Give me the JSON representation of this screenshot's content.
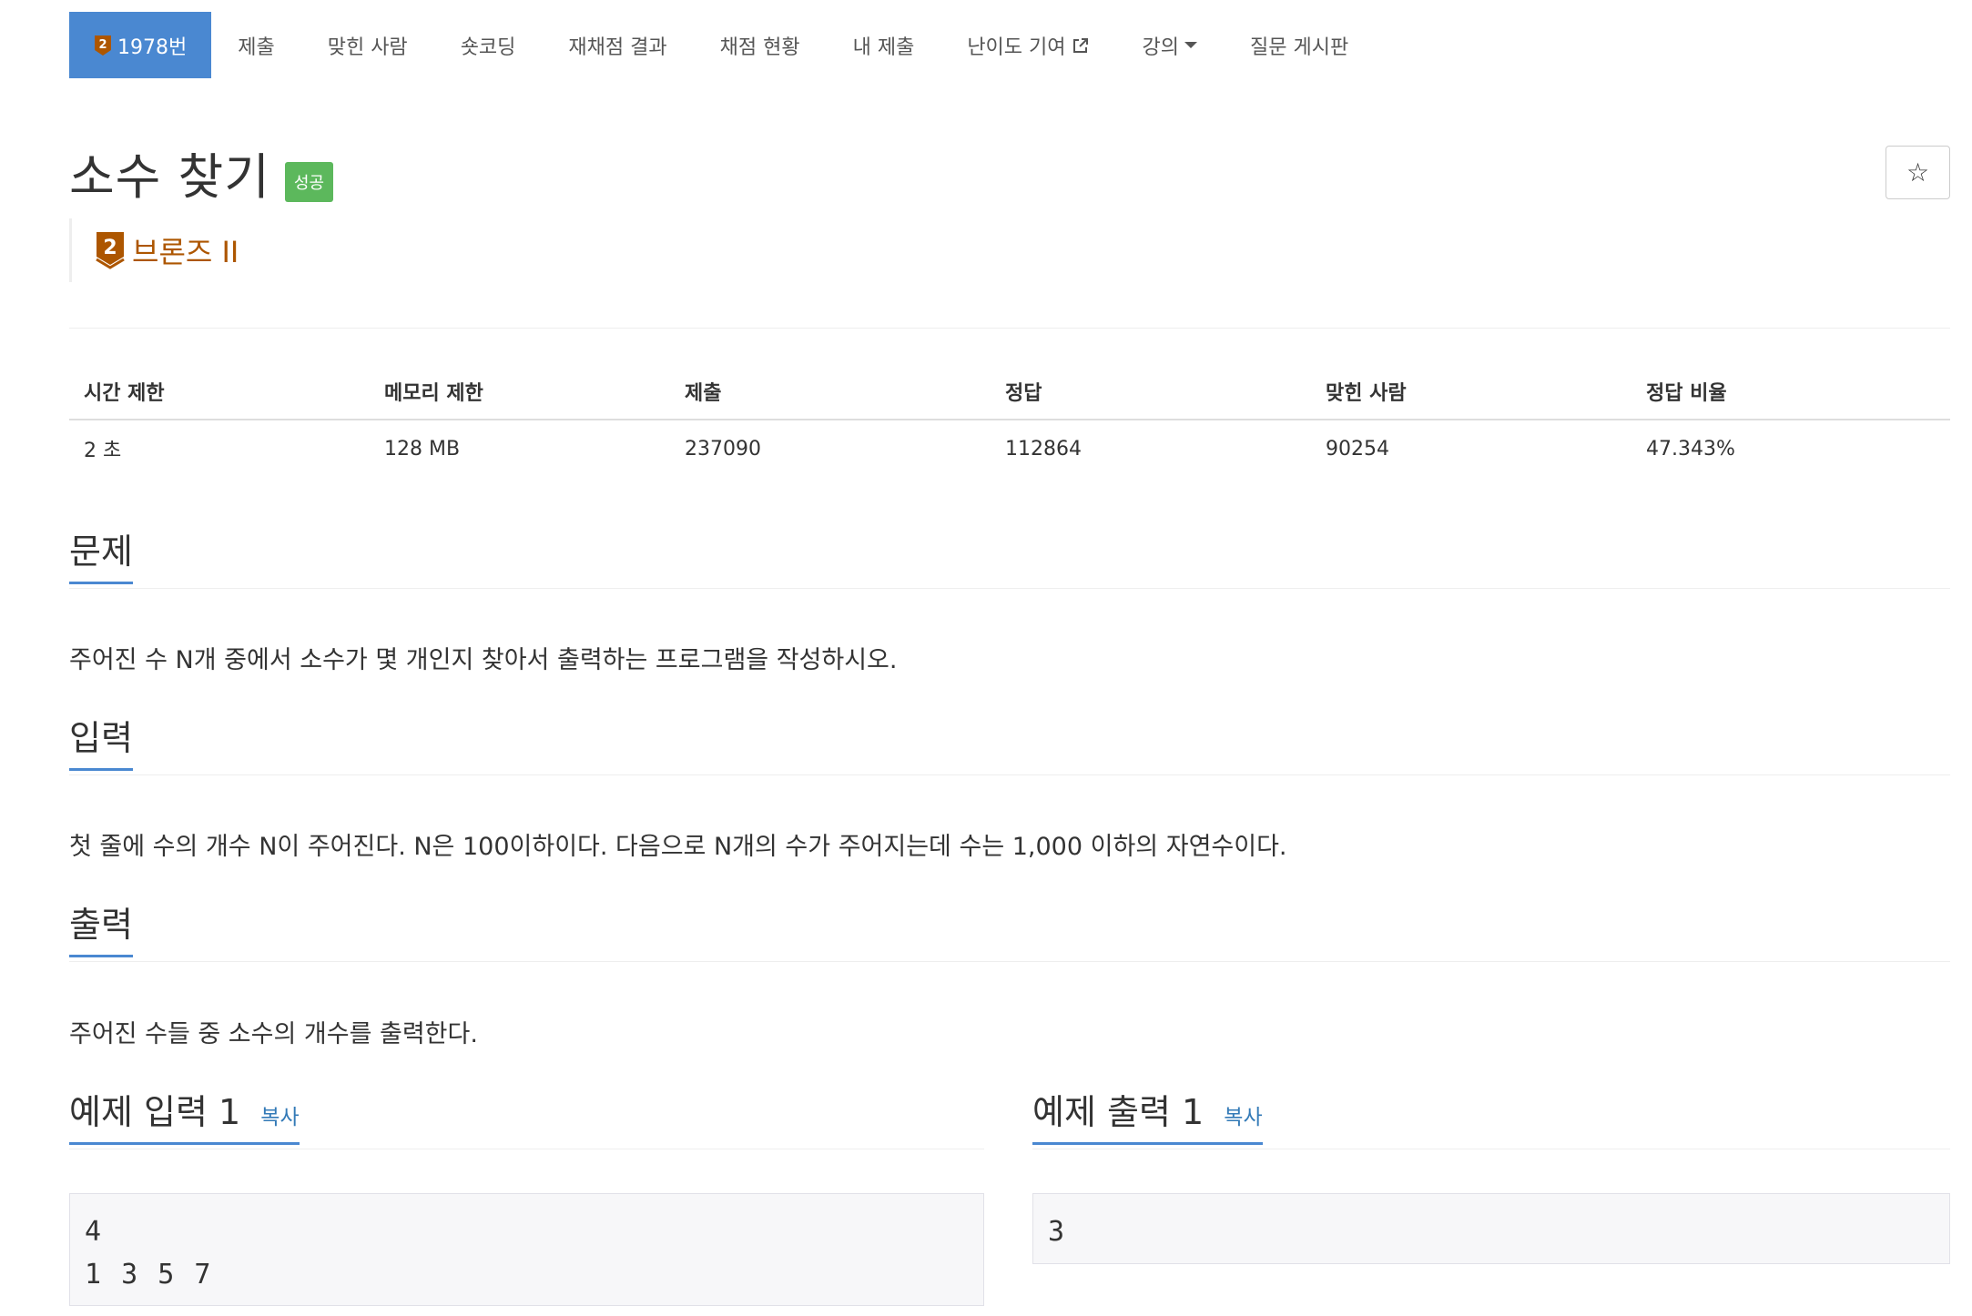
{
  "nav": {
    "problem_id": "1978번",
    "items": [
      "제출",
      "맞힌 사람",
      "숏코딩",
      "재채점 결과",
      "채점 현황",
      "내 제출",
      "난이도 기여",
      "강의",
      "질문 게시판"
    ]
  },
  "tier": {
    "level": "2",
    "name": "브론즈 II",
    "color": "#ad5600"
  },
  "title": "소수 찾기",
  "status_badge": "성공",
  "star": "☆",
  "info": {
    "headers": [
      "시간 제한",
      "메모리 제한",
      "제출",
      "정답",
      "맞힌 사람",
      "정답 비율"
    ],
    "values": [
      "2 초",
      "128 MB",
      "237090",
      "112864",
      "90254",
      "47.343%"
    ]
  },
  "sections": {
    "problem": {
      "title": "문제",
      "text": "주어진 수 N개 중에서 소수가 몇 개인지 찾아서 출력하는 프로그램을 작성하시오."
    },
    "input": {
      "title": "입력",
      "text": "첫 줄에 수의 개수 N이 주어진다. N은 100이하이다. 다음으로 N개의 수가 주어지는데 수는 1,000 이하의 자연수이다."
    },
    "output": {
      "title": "출력",
      "text": "주어진 수들 중 소수의 개수를 출력한다."
    }
  },
  "samples": {
    "copy_label": "복사",
    "input_title": "예제 입력 1",
    "output_title": "예제 출력 1",
    "input_lines": [
      "4",
      "1 3 5 7"
    ],
    "output_lines": [
      "3"
    ]
  },
  "colors": {
    "accent": "#4a88d1",
    "success": "#5cb85c",
    "bronze": "#ad5600",
    "link": "#337ab7"
  }
}
